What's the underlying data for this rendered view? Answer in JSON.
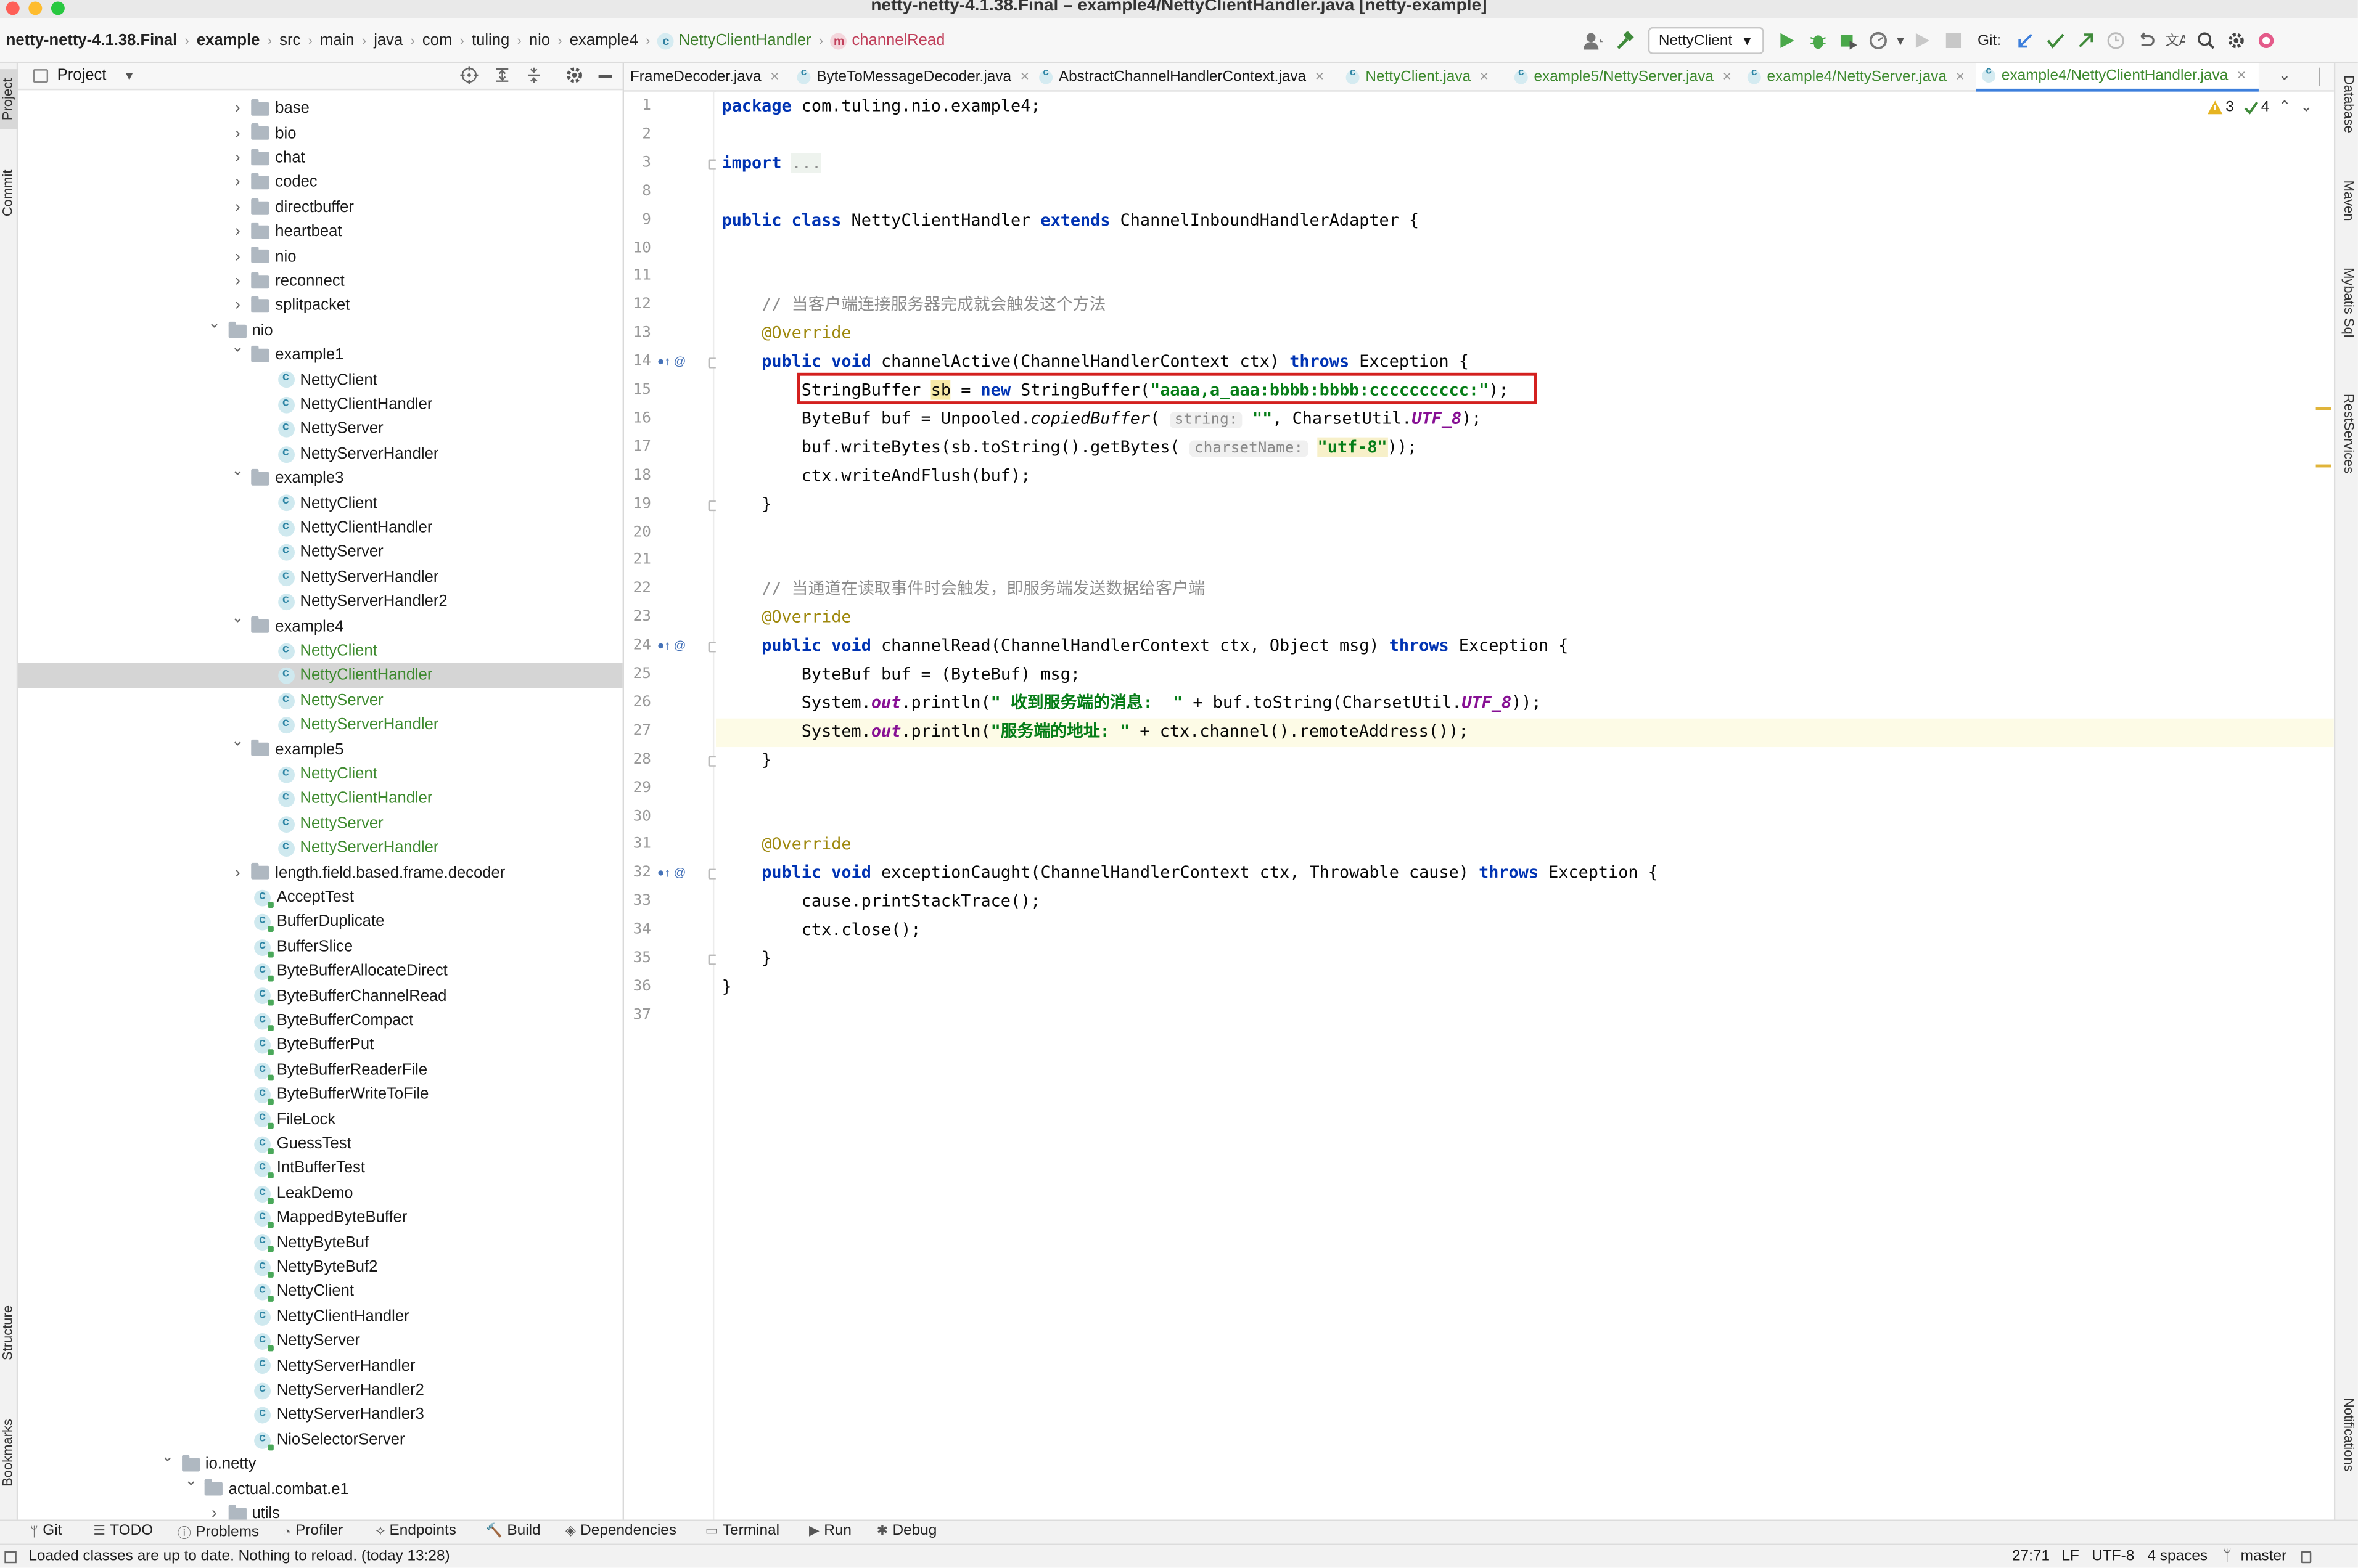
{
  "window": {
    "title": "netty-netty-4.1.38.Final – example4/NettyClientHandler.java [netty-example]"
  },
  "breadcrumb": [
    "netty-netty-4.1.38.Final",
    "example",
    "src",
    "main",
    "java",
    "com",
    "tuling",
    "nio",
    "example4",
    "NettyClientHandler",
    "channelRead"
  ],
  "toolbar": {
    "run_config": "NettyClient",
    "git_label": "Git:"
  },
  "project_panel": {
    "title": "Project",
    "tree": [
      {
        "label": "base",
        "kind": "folder",
        "depth": 2,
        "expanded": false
      },
      {
        "label": "bio",
        "kind": "folder",
        "depth": 2,
        "expanded": false
      },
      {
        "label": "chat",
        "kind": "folder",
        "depth": 2,
        "expanded": false
      },
      {
        "label": "codec",
        "kind": "folder",
        "depth": 2,
        "expanded": false
      },
      {
        "label": "directbuffer",
        "kind": "folder",
        "depth": 2,
        "expanded": false
      },
      {
        "label": "heartbeat",
        "kind": "folder",
        "depth": 2,
        "expanded": false
      },
      {
        "label": "nio",
        "kind": "folder",
        "depth": 2,
        "expanded": false
      },
      {
        "label": "reconnect",
        "kind": "folder",
        "depth": 2,
        "expanded": false
      },
      {
        "label": "splitpacket",
        "kind": "folder",
        "depth": 2,
        "expanded": false
      },
      {
        "label": "nio",
        "kind": "folder",
        "depth": 1,
        "expanded": true
      },
      {
        "label": "example1",
        "kind": "folder",
        "depth": 2,
        "expanded": true
      },
      {
        "label": "NettyClient",
        "kind": "class",
        "depth": 3
      },
      {
        "label": "NettyClientHandler",
        "kind": "class",
        "depth": 3
      },
      {
        "label": "NettyServer",
        "kind": "class",
        "depth": 3
      },
      {
        "label": "NettyServerHandler",
        "kind": "class",
        "depth": 3
      },
      {
        "label": "example3",
        "kind": "folder",
        "depth": 2,
        "expanded": true
      },
      {
        "label": "NettyClient",
        "kind": "class",
        "depth": 3
      },
      {
        "label": "NettyClientHandler",
        "kind": "class",
        "depth": 3
      },
      {
        "label": "NettyServer",
        "kind": "class",
        "depth": 3
      },
      {
        "label": "NettyServerHandler",
        "kind": "class",
        "depth": 3
      },
      {
        "label": "NettyServerHandler2",
        "kind": "class",
        "depth": 3
      },
      {
        "label": "example4",
        "kind": "folder",
        "depth": 2,
        "expanded": true
      },
      {
        "label": "NettyClient",
        "kind": "class",
        "depth": 3,
        "green": true
      },
      {
        "label": "NettyClientHandler",
        "kind": "class",
        "depth": 3,
        "green": true,
        "selected": true
      },
      {
        "label": "NettyServer",
        "kind": "class",
        "depth": 3,
        "green": true
      },
      {
        "label": "NettyServerHandler",
        "kind": "class",
        "depth": 3,
        "green": true
      },
      {
        "label": "example5",
        "kind": "folder",
        "depth": 2,
        "expanded": true
      },
      {
        "label": "NettyClient",
        "kind": "class",
        "depth": 3,
        "green": true
      },
      {
        "label": "NettyClientHandler",
        "kind": "class",
        "depth": 3,
        "green": true
      },
      {
        "label": "NettyServer",
        "kind": "class",
        "depth": 3,
        "green": true
      },
      {
        "label": "NettyServerHandler",
        "kind": "class",
        "depth": 3,
        "green": true
      },
      {
        "label": "length.field.based.frame.decoder",
        "kind": "folder",
        "depth": 2,
        "expanded": false
      },
      {
        "label": "AcceptTest",
        "kind": "class",
        "depth": 2,
        "run": true
      },
      {
        "label": "BufferDuplicate",
        "kind": "class",
        "depth": 2,
        "run": true
      },
      {
        "label": "BufferSlice",
        "kind": "class",
        "depth": 2,
        "run": true
      },
      {
        "label": "ByteBufferAllocateDirect",
        "kind": "class",
        "depth": 2,
        "run": true
      },
      {
        "label": "ByteBufferChannelRead",
        "kind": "class",
        "depth": 2,
        "run": true
      },
      {
        "label": "ByteBufferCompact",
        "kind": "class",
        "depth": 2,
        "run": true
      },
      {
        "label": "ByteBufferPut",
        "kind": "class",
        "depth": 2,
        "run": true
      },
      {
        "label": "ByteBufferReaderFile",
        "kind": "class",
        "depth": 2,
        "run": true
      },
      {
        "label": "ByteBufferWriteToFile",
        "kind": "class",
        "depth": 2,
        "run": true
      },
      {
        "label": "FileLock",
        "kind": "class",
        "depth": 2,
        "run": true
      },
      {
        "label": "GuessTest",
        "kind": "class",
        "depth": 2,
        "run": true
      },
      {
        "label": "IntBufferTest",
        "kind": "class",
        "depth": 2,
        "run": true
      },
      {
        "label": "LeakDemo",
        "kind": "class",
        "depth": 2,
        "run": true
      },
      {
        "label": "MappedByteBuffer",
        "kind": "class",
        "depth": 2,
        "run": true
      },
      {
        "label": "NettyByteBuf",
        "kind": "class",
        "depth": 2,
        "run": true
      },
      {
        "label": "NettyByteBuf2",
        "kind": "class",
        "depth": 2,
        "run": true
      },
      {
        "label": "NettyClient",
        "kind": "class",
        "depth": 2,
        "run": true
      },
      {
        "label": "NettyClientHandler",
        "kind": "class",
        "depth": 2
      },
      {
        "label": "NettyServer",
        "kind": "class",
        "depth": 2,
        "run": true
      },
      {
        "label": "NettyServerHandler",
        "kind": "class",
        "depth": 2
      },
      {
        "label": "NettyServerHandler2",
        "kind": "class",
        "depth": 2
      },
      {
        "label": "NettyServerHandler3",
        "kind": "class",
        "depth": 2
      },
      {
        "label": "NioSelectorServer",
        "kind": "class",
        "depth": 2,
        "run": true
      },
      {
        "label": "io.netty",
        "kind": "folder",
        "depth": -1,
        "expanded": true
      },
      {
        "label": "actual.combat.e1",
        "kind": "folder",
        "depth": 0,
        "expanded": true
      },
      {
        "label": "utils",
        "kind": "folder",
        "depth": 1,
        "expanded": false
      }
    ]
  },
  "editor_tabs": [
    {
      "label": "FrameDecoder.java",
      "green": false,
      "active": false
    },
    {
      "label": "ByteToMessageDecoder.java",
      "green": false,
      "active": false
    },
    {
      "label": "AbstractChannelHandlerContext.java",
      "green": false,
      "active": false
    },
    {
      "label": "NettyClient.java",
      "green": true,
      "active": false
    },
    {
      "label": "example5/NettyServer.java",
      "green": true,
      "active": false
    },
    {
      "label": "example4/NettyServer.java",
      "green": true,
      "active": false
    },
    {
      "label": "example4/NettyClientHandler.java",
      "green": true,
      "active": true
    }
  ],
  "inspections": {
    "warnings": "3",
    "ok": "4"
  },
  "code_lines": [
    {
      "n": "1",
      "html": "<span class=\"kw\">package</span> com.tuling.nio.example4;"
    },
    {
      "n": "2",
      "html": ""
    },
    {
      "n": "3",
      "html": "<span class=\"kw\">import</span> <span class=\"cmt\" style=\"background:#eef3ee\">...</span>"
    },
    {
      "n": "8",
      "html": ""
    },
    {
      "n": "9",
      "html": "<span class=\"kw\">public class</span> NettyClientHandler <span class=\"kw\">extends</span> ChannelInboundHandlerAdapter {"
    },
    {
      "n": "10",
      "html": ""
    },
    {
      "n": "11",
      "html": ""
    },
    {
      "n": "12",
      "html": "    <span class=\"cmt\">// 当客户端连接服务器完成就会触发这个方法</span>"
    },
    {
      "n": "13",
      "html": "    <span class=\"ann\">@Override</span>"
    },
    {
      "n": "14",
      "html": "    <span class=\"kw\">public void</span> channelActive(ChannelHandlerContext ctx) <span class=\"kw\">throws</span> Exception {"
    },
    {
      "n": "15",
      "html": "        StringBuffer <span class=\"hlvar\">sb</span> = <span class=\"kw\">new</span> StringBuffer(<span class=\"str\">\"aaaa,a_aaa:bbbb:bbbb:cccccccccc:\"</span>);"
    },
    {
      "n": "16",
      "html": "        ByteBuf buf = Unpooled.<i>copiedBuffer</i>( <span class=\"hint\">string:</span> <span class=\"str\">\"\"</span>, CharsetUtil.<span class=\"out\">UTF_8</span>);"
    },
    {
      "n": "17",
      "html": "        buf.writeBytes(sb.toString().getBytes( <span class=\"hint\">charsetName:</span> <span class=\"str\" style=\"background:#f7f0c9\">\"utf-8\"</span>));"
    },
    {
      "n": "18",
      "html": "        ctx.writeAndFlush(buf);"
    },
    {
      "n": "19",
      "html": "    }"
    },
    {
      "n": "20",
      "html": ""
    },
    {
      "n": "21",
      "html": ""
    },
    {
      "n": "22",
      "html": "    <span class=\"cmt\">// 当通道在读取事件时会触发，即服务端发送数据给客户端</span>"
    },
    {
      "n": "23",
      "html": "    <span class=\"ann\">@Override</span>"
    },
    {
      "n": "24",
      "html": "    <span class=\"kw\">public void</span> channelRead(ChannelHandlerContext ctx, Object msg) <span class=\"kw\">throws</span> Exception {"
    },
    {
      "n": "25",
      "html": "        ByteBuf buf = (ByteBuf) msg;"
    },
    {
      "n": "26",
      "html": "        System.<span class=\"out\">out</span>.println(<span class=\"str\">\" 收到服务端的消息:  \"</span> + buf.toString(CharsetUtil.<span class=\"out\">UTF_8</span>));"
    },
    {
      "n": "27",
      "html": "        System.<span class=\"out\">out</span>.println(<span class=\"str\">\"服务端的地址: \"</span> + ctx.channel().remoteAddress());"
    },
    {
      "n": "28",
      "html": "    }"
    },
    {
      "n": "29",
      "html": ""
    },
    {
      "n": "30",
      "html": ""
    },
    {
      "n": "31",
      "html": "    <span class=\"ann\">@Override</span>"
    },
    {
      "n": "32",
      "html": "    <span class=\"kw\">public void</span> exceptionCaught(ChannelHandlerContext ctx, Throwable cause) <span class=\"kw\">throws</span> Exception {"
    },
    {
      "n": "33",
      "html": "        cause.printStackTrace();"
    },
    {
      "n": "34",
      "html": "        ctx.close();"
    },
    {
      "n": "35",
      "html": "    }"
    },
    {
      "n": "36",
      "html": "}"
    },
    {
      "n": "37",
      "html": ""
    }
  ],
  "tool_windows": {
    "left": [
      "Project",
      "Commit",
      "Structure",
      "Bookmarks"
    ],
    "right": [
      "Database",
      "Maven",
      "Mybatis Sql",
      "RestServices",
      "Notifications"
    ]
  },
  "bottom_tools": [
    {
      "label": "Git",
      "icon": "git-branch-icon"
    },
    {
      "label": "TODO",
      "icon": "list-icon"
    },
    {
      "label": "Problems",
      "icon": "problems-icon"
    },
    {
      "label": "Profiler",
      "icon": "profiler-icon"
    },
    {
      "label": "Endpoints",
      "icon": "endpoints-icon"
    },
    {
      "label": "Build",
      "icon": "hammer-icon"
    },
    {
      "label": "Dependencies",
      "icon": "dependencies-icon"
    },
    {
      "label": "Terminal",
      "icon": "terminal-icon"
    },
    {
      "label": "Run",
      "icon": "run-icon"
    },
    {
      "label": "Debug",
      "icon": "bug-icon"
    }
  ],
  "status": {
    "message": "Loaded classes are up to date. Nothing to reload. (today 13:28)",
    "position": "27:71",
    "line_sep": "LF",
    "encoding": "UTF-8",
    "indent": "4 spaces",
    "branch": "master"
  }
}
